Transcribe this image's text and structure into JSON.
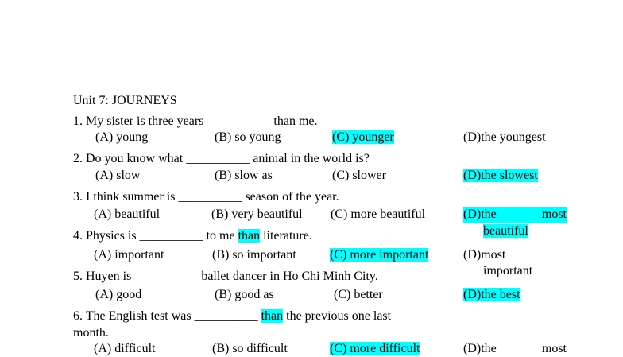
{
  "title": "Unit 7: JOURNEYS",
  "highlight_color": "#00ffff",
  "questions": [
    {
      "stem": "1. My sister is three years __________ than me.",
      "options": [
        "(A) young",
        "(B) so young",
        "(C) younger",
        "(D)the youngest"
      ],
      "highlighted_option": "C"
    },
    {
      "stem": "2. Do you know what __________ animal in the world is?",
      "options": [
        "(A) slow",
        "(B) slow as",
        "(C) slower",
        "(D)the slowest"
      ],
      "highlighted_option": "D"
    },
    {
      "stem": "3. I think summer is __________ season of the year.",
      "options": [
        "(A) beautiful",
        "(B) very beautiful",
        "(C) more beautiful",
        "(D)the",
        "most",
        "beautiful"
      ],
      "highlighted_option": "D"
    },
    {
      "stem_before": "4. Physics is __________ to me ",
      "stem_highlight": "than",
      "stem_after": " literature.",
      "options": [
        "(A) important",
        "(B) so important",
        "(C) more important",
        "(D)most",
        "important"
      ],
      "highlighted_option": "C"
    },
    {
      "stem": "5. Huyen is __________ ballet dancer in Ho Chi Minh City.",
      "options": [
        "(A) good",
        "(B) good as",
        "(C) better",
        "(D)the best"
      ],
      "highlighted_option": "D"
    },
    {
      "stem_before": "6. The English test was __________ ",
      "stem_highlight": "than",
      "stem_after": " the previous one last",
      "stem_line2": "month.",
      "options": [
        "(A) difficult",
        "(B) so difficult",
        "(C) more difficult",
        "(D)the",
        "most"
      ],
      "highlighted_option": "C"
    }
  ]
}
